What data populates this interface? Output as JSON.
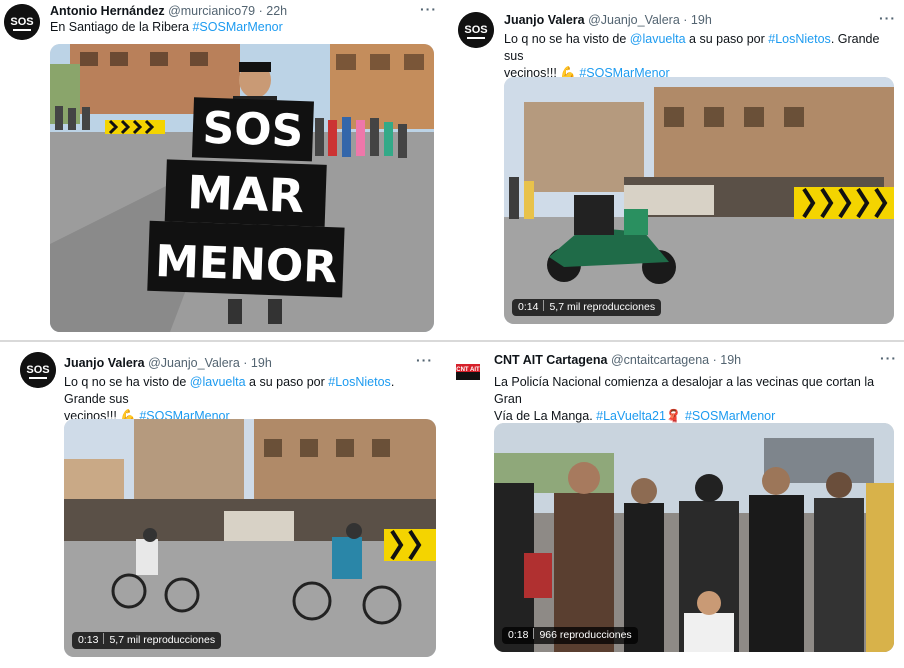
{
  "tweets": [
    {
      "avatar_text": "SOS",
      "name": "Antonio Hernández",
      "handle": "@murcianico79",
      "sep": "·",
      "time": "22h",
      "more": "···",
      "text_plain": "En Santiago de la Ribera ",
      "hashtag": "#SOSMarMenor",
      "sign_lines": [
        "SOS",
        "MAR",
        "MENOR"
      ]
    },
    {
      "avatar_text": "SOS",
      "name": "Juanjo Valera",
      "handle": "@Juanjo_Valera",
      "sep": "·",
      "time": "19h",
      "more": "···",
      "text_a": "Lo q no se ha visto de ",
      "mention": "@lavuelta",
      "text_b": " a su paso por ",
      "hashtag1": "#LosNietos",
      "text_c": ". Grande sus",
      "text_d": "vecinos!!! 💪",
      "hashtag2": "#SOSMarMenor",
      "video_time": "0:14",
      "video_views": "5,7 mil reproducciones"
    },
    {
      "avatar_text": "SOS",
      "name": "Juanjo Valera",
      "handle": "@Juanjo_Valera",
      "sep": "·",
      "time": "19h",
      "more": "···",
      "text_a": "Lo q no se ha visto de ",
      "mention": "@lavuelta",
      "text_b": " a su paso por ",
      "hashtag1": "#LosNietos",
      "text_c": ". Grande sus",
      "text_d": "vecinos!!! 💪",
      "hashtag2": "#SOSMarMenor",
      "video_time": "0:13",
      "video_views": "5,7 mil reproducciones"
    },
    {
      "avatar_text": "CNT AIT",
      "name": "CNT AIT Cartagena",
      "handle": "@cntaitcartagena",
      "sep": "·",
      "time": "19h",
      "more": "···",
      "text_a": "La Policía Nacional comienza a desalojar a las vecinas que cortan la Gran",
      "text_b": "Vía de La Manga. ",
      "hashtag1": "#LaVuelta21",
      "emoji": "🧣",
      "hashtag2": "#SOSMarMenor",
      "video_time": "0:18",
      "video_views": "966 reproducciones"
    }
  ],
  "colors": {
    "link": "#1d9bf0",
    "secondary_text": "#536471",
    "cnt_red": "#d6202a",
    "road_barrier_yellow": "#f4d400"
  }
}
